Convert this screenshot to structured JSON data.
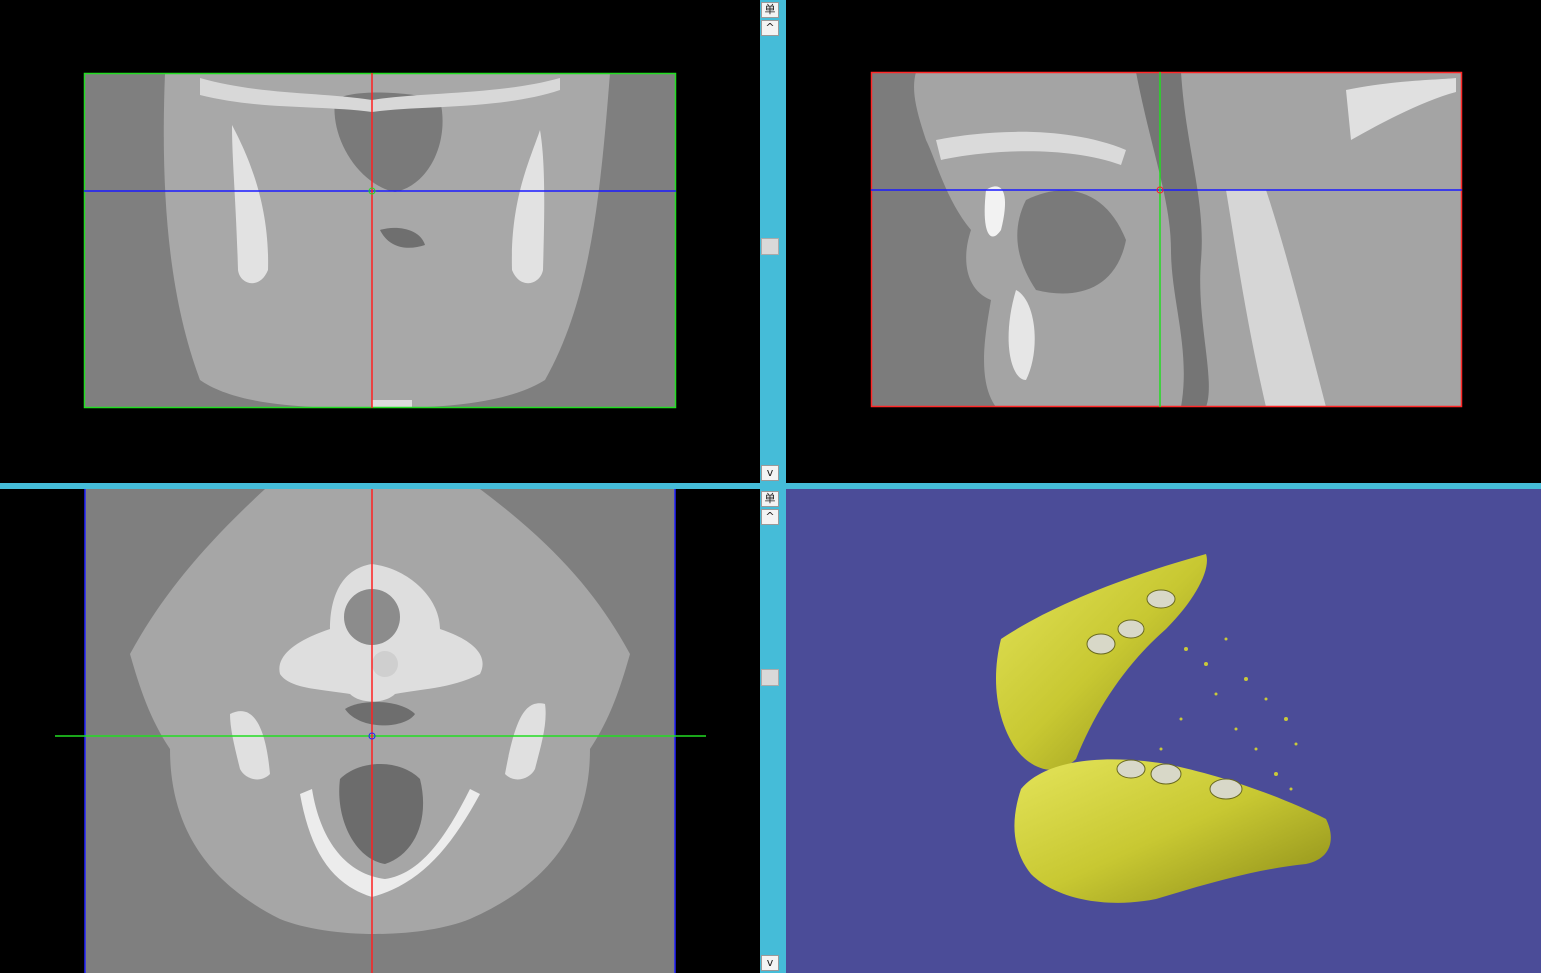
{
  "viewer": {
    "mode_label": "单",
    "scroll_up_glyph": "^",
    "scroll_down_glyph": "v"
  },
  "views": {
    "coronal": {
      "frame_color": "#22dd22",
      "h_line_color": "#1a1aff",
      "v_line_color": "#ff2020"
    },
    "sagittal": {
      "frame_color": "#ff2828",
      "h_line_color": "#1a1aff",
      "v_line_color": "#22dd22"
    },
    "axial": {
      "frame_color": "#2222ff",
      "h_line_color": "#22dd22",
      "v_line_color": "#ff2020"
    },
    "render3d": {
      "background": "#4b4c98",
      "model_color": "#c9c93a"
    }
  },
  "scroll_positions": {
    "top": 0.5,
    "bottom": 0.4
  }
}
